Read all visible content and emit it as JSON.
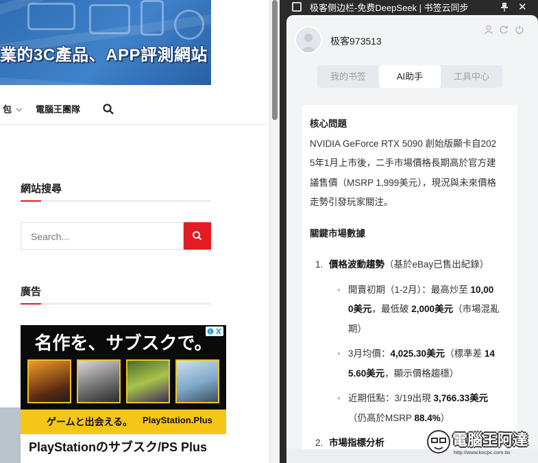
{
  "left_page": {
    "banner_text": "業的3C產品、APP評測網站",
    "nav": {
      "item_1": "包",
      "item_2": "電腦王團隊"
    },
    "site_search": {
      "title": "網站搜尋",
      "placeholder": "Search..."
    },
    "ad_section": {
      "title": "廣告",
      "headline": "名作を、サブスクで。",
      "band_text": "ゲームと出会える。",
      "brand": "PlayStation.Plus",
      "subtitle": "PlayStationのサブスク/PS Plus"
    }
  },
  "sidebar": {
    "window_title": "极客侧边栏-免费DeepSeek | 书签云同步",
    "username": "极客973513",
    "tabs": [
      {
        "label": "我的书签",
        "active": false
      },
      {
        "label": "AI助手",
        "active": true
      },
      {
        "label": "工具中心",
        "active": false
      }
    ],
    "message": {
      "core_heading": "核心問題",
      "core_lines": [
        "NVIDIA GeForce RTX 5090 創始版顯卡自202",
        "5年1月上市後，二手市場價格長期高於官方建",
        "議售價（MSRP 1,999美元），現況與未來價格",
        "走勢引發玩家關注。"
      ],
      "data_heading": "關鍵市場數據",
      "item1": {
        "num": "1.",
        "title": "價格波動趨勢",
        "note": "（基於eBay已售出紀錄）",
        "bullets": [
          {
            "a": "開賣初期（1-2月）：最高炒至 ",
            "b1": "10,00",
            "b2": "0美元",
            "c": "，最低破 ",
            "d": "2,000美元",
            "e1": "（市場混亂",
            "e2": "期）"
          },
          {
            "a": "3月均價：",
            "b": "4,025.30美元",
            "c": "（標準差 ",
            "d1": "14",
            "d2": "5.60美元",
            "e": "，顯示價格趨穩）"
          },
          {
            "a": "近期低點：3/19出現 ",
            "b": "3,766.33美元",
            "c": "（仍高於MSRP ",
            "d": "88.4%",
            "e": "）"
          }
        ]
      },
      "item2": {
        "num": "2.",
        "title": "市場指標分析"
      }
    }
  },
  "watermark": {
    "title": "電腦王阿達",
    "url": "http://www.kocpc.com.tw"
  },
  "colors": {
    "accent_red": "#e31b23",
    "banner_blue": "#3a7cc4",
    "sidebar_dark": "#2a2a2a",
    "panel_bg": "#f3f4f6"
  }
}
